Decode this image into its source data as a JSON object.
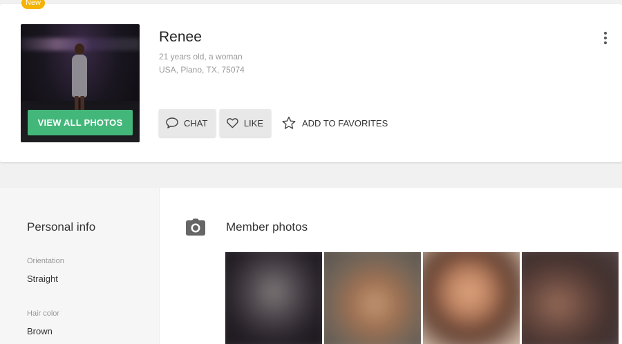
{
  "badge": {
    "new_label": "New"
  },
  "profile": {
    "name": "Renee",
    "age_gender": "21 years old, a woman",
    "location": "USA, Plano, TX, 75074",
    "view_photos_label": "VIEW ALL PHOTOS",
    "photo_icon": "profile-photo",
    "more_icon": "more-vertical-icon"
  },
  "actions": {
    "chat_label": "CHAT",
    "like_label": "LIKE",
    "favorites_label": "ADD TO FAVORITES",
    "icons": {
      "chat": "chat-bubble-icon",
      "like": "heart-icon",
      "favorites": "star-icon"
    }
  },
  "personal_info": {
    "title": "Personal info",
    "fields": [
      {
        "label": "Orientation",
        "value": "Straight"
      },
      {
        "label": "Hair color",
        "value": "Brown"
      }
    ]
  },
  "member_photos": {
    "title": "Member photos",
    "icon": "camera-icon",
    "thumbnails": [
      "photo-1",
      "photo-2",
      "photo-3",
      "photo-4"
    ]
  },
  "colors": {
    "accent_green": "#43b77a",
    "badge_yellow": "#f4b400",
    "muted_text": "#999999"
  }
}
